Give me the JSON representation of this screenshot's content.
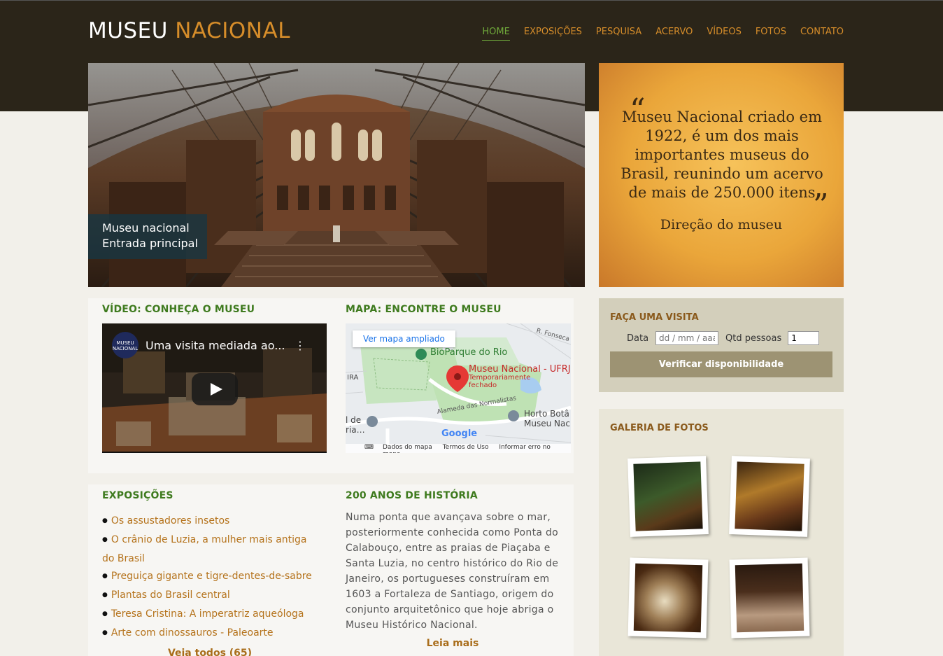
{
  "header": {
    "logo_part1": "MUSEU",
    "logo_part2": "NACIONAL",
    "nav": [
      {
        "label": "HOME",
        "active": true
      },
      {
        "label": "EXPOSIÇÕES"
      },
      {
        "label": "PESQUISA"
      },
      {
        "label": "ACERVO"
      },
      {
        "label": "VÍDEOS"
      },
      {
        "label": "FOTOS"
      },
      {
        "label": "CONTATO"
      }
    ]
  },
  "hero": {
    "caption_line1": "Museu nacional",
    "caption_line2": "Entrada principal"
  },
  "quote": {
    "text": "Museu Nacional criado em 1922, é um dos mais importantes museus do Brasil, reunindo um acervo de mais de 250.000 itens",
    "author": "Direção do museu"
  },
  "video": {
    "section_title": "VÍDEO: CONHEÇA O MUSEU",
    "video_title": "Uma visita mediada ao...",
    "channel_logo": "MUSEU NACIONAL"
  },
  "map": {
    "section_title": "MAPA: ENCONTRE O MUSEU",
    "enlarge_button": "Ver mapa ampliado",
    "labels": {
      "bioparque": "BioParque do Rio",
      "museu": "Museu Nacional - UFRJ",
      "status_line1": "Temporariamente",
      "status_line2": "fechado",
      "alameda": "Alameda das Normalistas",
      "horto_line1": "Horto Botâ",
      "horto_line2": "Museu Nac",
      "fonseca": "R. Fonseca",
      "ira": "IRA",
      "left_line1": "l de",
      "left_line2": "ria…",
      "google": "Google"
    },
    "footer": [
      "Dados do mapa",
      "Termos de Uso",
      "Informar erro no mapa"
    ]
  },
  "exhibitions": {
    "section_title": "EXPOSIÇÕES",
    "items": [
      "Os assustadores insetos",
      "O crânio de Luzia, a mulher mais antiga do Brasil",
      "Preguiça gigante e tigre-dentes-de-sabre",
      "Plantas do Brasil central",
      "Teresa Cristina: A imperatriz aqueóloga",
      "Arte com dinossauros - Paleoarte"
    ],
    "see_all": "Veja todos (65)"
  },
  "history": {
    "section_title": "200 ANOS DE HISTÓRIA",
    "text": "Numa ponta que avançava sobre o mar, posteriormente conhecida como Ponta do Calabouço, entre as praias de Piaçaba e Santa Luzia, no centro histórico do Rio de Janeiro, os portugueses construíram em 1603 a Fortaleza de Santiago, origem do conjunto arquitetônico que hoje abriga o Museu Histórico Nacional.",
    "read_more": "Leia mais"
  },
  "visit": {
    "title": "FAÇA UMA VISITA",
    "date_label": "Data",
    "date_placeholder": "dd / mm / aaaa",
    "qty_label": "Qtd pessoas",
    "qty_value": "1",
    "button": "Verificar disponibilidade"
  },
  "gallery": {
    "title": "GALERIA DE FOTOS"
  },
  "colors": {
    "header_bg": "#2b2519",
    "accent_orange": "#d68d2a",
    "nav_active": "#6fa83a",
    "section_title_green": "#3f7b1f",
    "link_orange": "#b5731c"
  }
}
